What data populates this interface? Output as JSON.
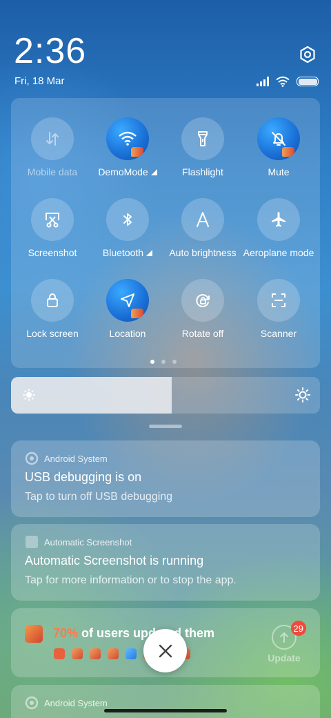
{
  "header": {
    "time": "2:36",
    "date": "Fri, 18 Mar"
  },
  "quick_settings": {
    "tiles": [
      {
        "label": "Mobile data",
        "state": "disabled",
        "icon": "mobile-data-icon"
      },
      {
        "label": "DemoMode",
        "state": "on",
        "icon": "wifi-icon",
        "has_more": true
      },
      {
        "label": "Flashlight",
        "state": "off",
        "icon": "flashlight-icon"
      },
      {
        "label": "Mute",
        "state": "on",
        "icon": "bell-off-icon"
      },
      {
        "label": "Screenshot",
        "state": "off",
        "icon": "screenshot-icon"
      },
      {
        "label": "Bluetooth",
        "state": "off",
        "icon": "bluetooth-icon",
        "has_more": true
      },
      {
        "label": "Auto brightness",
        "state": "off",
        "icon": "auto-brightness-icon"
      },
      {
        "label": "Aeroplane mode",
        "state": "off",
        "icon": "airplane-icon"
      },
      {
        "label": "Lock screen",
        "state": "off",
        "icon": "lock-icon"
      },
      {
        "label": "Location",
        "state": "on",
        "icon": "location-icon"
      },
      {
        "label": "Rotate off",
        "state": "off",
        "icon": "rotate-lock-icon"
      },
      {
        "label": "Scanner",
        "state": "off",
        "icon": "scanner-icon"
      }
    ],
    "page": 1,
    "page_count": 3
  },
  "brightness": {
    "level": 0.52
  },
  "notifications": [
    {
      "app": "Android System",
      "title": "USB debugging is on",
      "body": "Tap to turn off USB debugging"
    },
    {
      "app": "Automatic Screenshot",
      "title": "Automatic Screenshot is running",
      "body": "Tap for more information or to stop the app."
    },
    {
      "promo_percent": "70%",
      "promo_text": " of users updated them",
      "update_label": "Update",
      "badge_count": "29"
    },
    {
      "app": "Android System"
    }
  ],
  "colors": {
    "accent_orange": "#ff7a4a",
    "badge_red": "#f04a3c",
    "tile_on_blue": "#1a6fd6"
  }
}
